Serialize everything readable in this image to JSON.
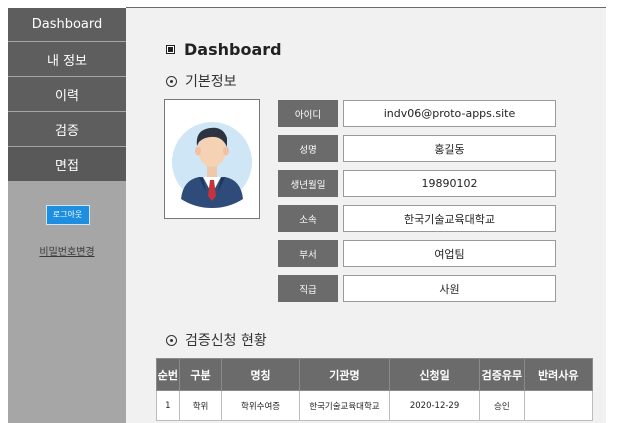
{
  "sidebar": {
    "items": [
      {
        "label": "Dashboard"
      },
      {
        "label": "내 정보"
      },
      {
        "label": "이력"
      },
      {
        "label": "검증"
      },
      {
        "label": "면접"
      }
    ],
    "logout_label": "로그아웃",
    "change_password_label": "비밀번호변경"
  },
  "main": {
    "title": "Dashboard",
    "basic_info_title": "기본정보",
    "profile": [
      {
        "label": "아이디",
        "value": "indv06@proto-apps.site"
      },
      {
        "label": "성명",
        "value": "홍길동"
      },
      {
        "label": "생년월일",
        "value": "19890102"
      },
      {
        "label": "소속",
        "value": "한국기술교육대학교"
      },
      {
        "label": "부서",
        "value": "여업팀"
      },
      {
        "label": "직급",
        "value": "사원"
      }
    ],
    "requests_title": "검증신청 현황",
    "requests_table": {
      "headers": [
        "순번",
        "구분",
        "명칭",
        "기관명",
        "신청일",
        "검증유무",
        "반려사유"
      ],
      "rows": [
        [
          "1",
          "학위",
          "학위수여증",
          "한국기술교육대학교",
          "2020-12-29",
          "승인",
          ""
        ]
      ]
    }
  },
  "colors": {
    "nav_bg": "#5e5e5e",
    "sidebar_bg": "#a6a6a6",
    "label_bg": "#6b6b6b",
    "logout_bg": "#1e8fe0",
    "main_bg": "#f1f1f1"
  }
}
